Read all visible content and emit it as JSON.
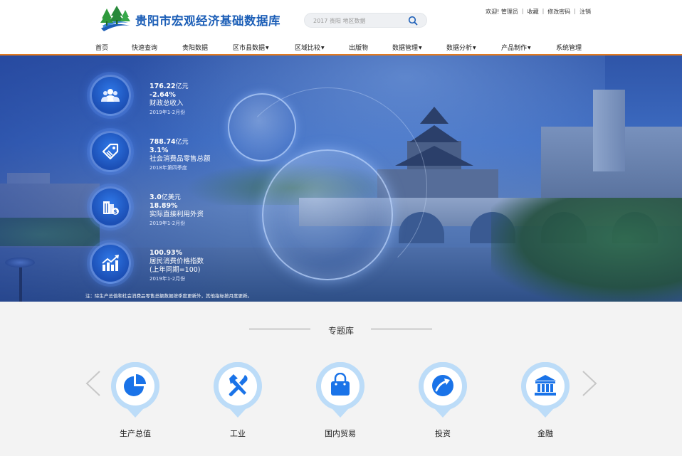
{
  "header": {
    "site_title": "贵阳市宏观经济基础数据库",
    "search_placeholder": "2017 贵阳 地区数据",
    "user_links": [
      "欢迎! 管理员",
      "收藏",
      "修改密码",
      "注销"
    ]
  },
  "nav": {
    "items": [
      {
        "label": "首页",
        "dropdown": false
      },
      {
        "label": "快速查询",
        "dropdown": false
      },
      {
        "label": "贵阳数据",
        "dropdown": false
      },
      {
        "label": "区市县数据",
        "dropdown": true
      },
      {
        "label": "区域比较",
        "dropdown": true
      },
      {
        "label": "出版物",
        "dropdown": false
      },
      {
        "label": "数据管理",
        "dropdown": true
      },
      {
        "label": "数据分析",
        "dropdown": true
      },
      {
        "label": "产品制作",
        "dropdown": true
      },
      {
        "label": "系统管理",
        "dropdown": false
      }
    ],
    "accent_color": "#e27a1f"
  },
  "banner": {
    "stats": [
      {
        "icon": "people-icon",
        "value": "176.22",
        "unit": "亿元",
        "change": "-2.64%",
        "name": "财政总收入",
        "date": "2019年1-2月份"
      },
      {
        "icon": "price-tag-icon",
        "value": "788.74",
        "unit": "亿元",
        "change": "3.1%",
        "name": "社会消费品零售总额",
        "date": "2018年第四季度"
      },
      {
        "icon": "building-dollar-icon",
        "value": "3.0",
        "unit": "亿美元",
        "change": "18.89%",
        "name": "实际直接利用外资",
        "date": "2019年1-2月份"
      },
      {
        "icon": "trend-chart-icon",
        "value": "100.93%",
        "unit": "",
        "change": "居民消费价格指数",
        "name": "(上年同期=100)",
        "date": "2019年1-2月份"
      }
    ],
    "note": "注：除生产总值和社会消费品零售总额数据按季度更新外，其他指标按月度更新。"
  },
  "topics": {
    "title": "专题库",
    "items": [
      {
        "label": "生产总值",
        "icon": "pie-chart-icon"
      },
      {
        "label": "工业",
        "icon": "tools-icon"
      },
      {
        "label": "国内贸易",
        "icon": "shopping-bag-icon"
      },
      {
        "label": "投资",
        "icon": "investment-icon"
      },
      {
        "label": "金融",
        "icon": "bank-icon"
      }
    ]
  },
  "colors": {
    "brand_blue": "#1d5fb7",
    "icon_blue": "#1a73e8",
    "pin_light": "#bcdcf8"
  }
}
